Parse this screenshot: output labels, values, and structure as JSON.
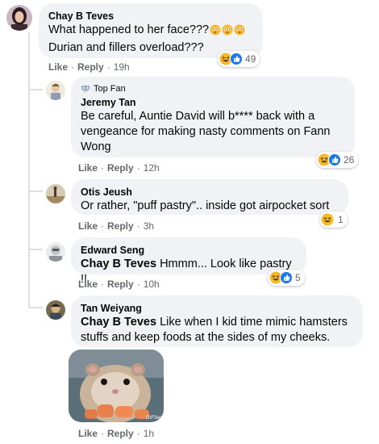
{
  "comments": [
    {
      "author": "Chay B Teves",
      "line1": "What happened to her face???",
      "line2": "Durian and fillers overload???",
      "like": "Like",
      "reply": "Reply",
      "time": "19h",
      "reaction_count": "49"
    },
    {
      "badge": "Top Fan",
      "author": "Jeremy Tan",
      "text": "Be careful, Auntie David will b**** back with a vengeance for making nasty comments on Fann Wong",
      "like": "Like",
      "reply": "Reply",
      "time": "12h",
      "reaction_count": "26"
    },
    {
      "author": "Otis Jeush",
      "text": "Or rather, \"puff pastry\".. inside got airpocket sort",
      "like": "Like",
      "reply": "Reply",
      "time": "3h",
      "reaction_count": "1"
    },
    {
      "author": "Edward Seng",
      "mention": "Chay B Teves",
      "text": "Hmmm... Look like pastry !!",
      "like": "Like",
      "reply": "Reply",
      "time": "10h",
      "reaction_count": "5"
    },
    {
      "author": "Tan Weiyang",
      "mention": "Chay B Teves",
      "text": "Like when I kid time mimic hamsters stuffs and keep foods at the sides of my cheeks.",
      "gif_label": "GIFSec",
      "like": "Like",
      "reply": "Reply",
      "time": "1h"
    }
  ],
  "separator": "·",
  "colors": {
    "bubble": "#f0f2f5",
    "meta": "#65676b",
    "like_blue": "#1877f2",
    "haha_yellow": "#f7b928"
  },
  "icons": [
    "haha-emoji-icon",
    "like-icon",
    "flushed-emoji-icon",
    "diamond-badge-icon"
  ]
}
